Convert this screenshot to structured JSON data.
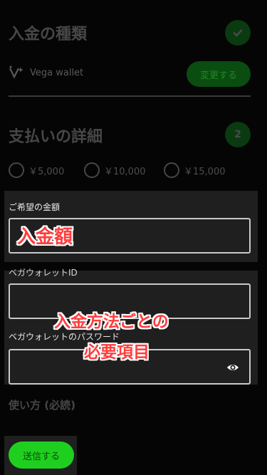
{
  "deposit_type": {
    "title": "入金の種類",
    "step_icon": "check-icon",
    "wallet_name": "Vega wallet",
    "change_button": "変更する"
  },
  "payment_details": {
    "title": "支払いの詳細",
    "step_number": "2",
    "amount_options": [
      "￥5,000",
      "￥10,000",
      "￥15,000"
    ],
    "amount_label": "ご希望の金額",
    "amount_overlay": "入金額",
    "wallet_id_label": "ベガウォレットID",
    "password_label": "ベガウォレットのパスワード",
    "fields_overlay_line1": "入金方法ごとの",
    "fields_overlay_line2": "必要項目"
  },
  "usage": {
    "title": "使い方 (必読)"
  },
  "submit_button": "送信する",
  "colors": {
    "accent_green": "#1fcf1f",
    "overlay_red": "#ff3d3d"
  }
}
